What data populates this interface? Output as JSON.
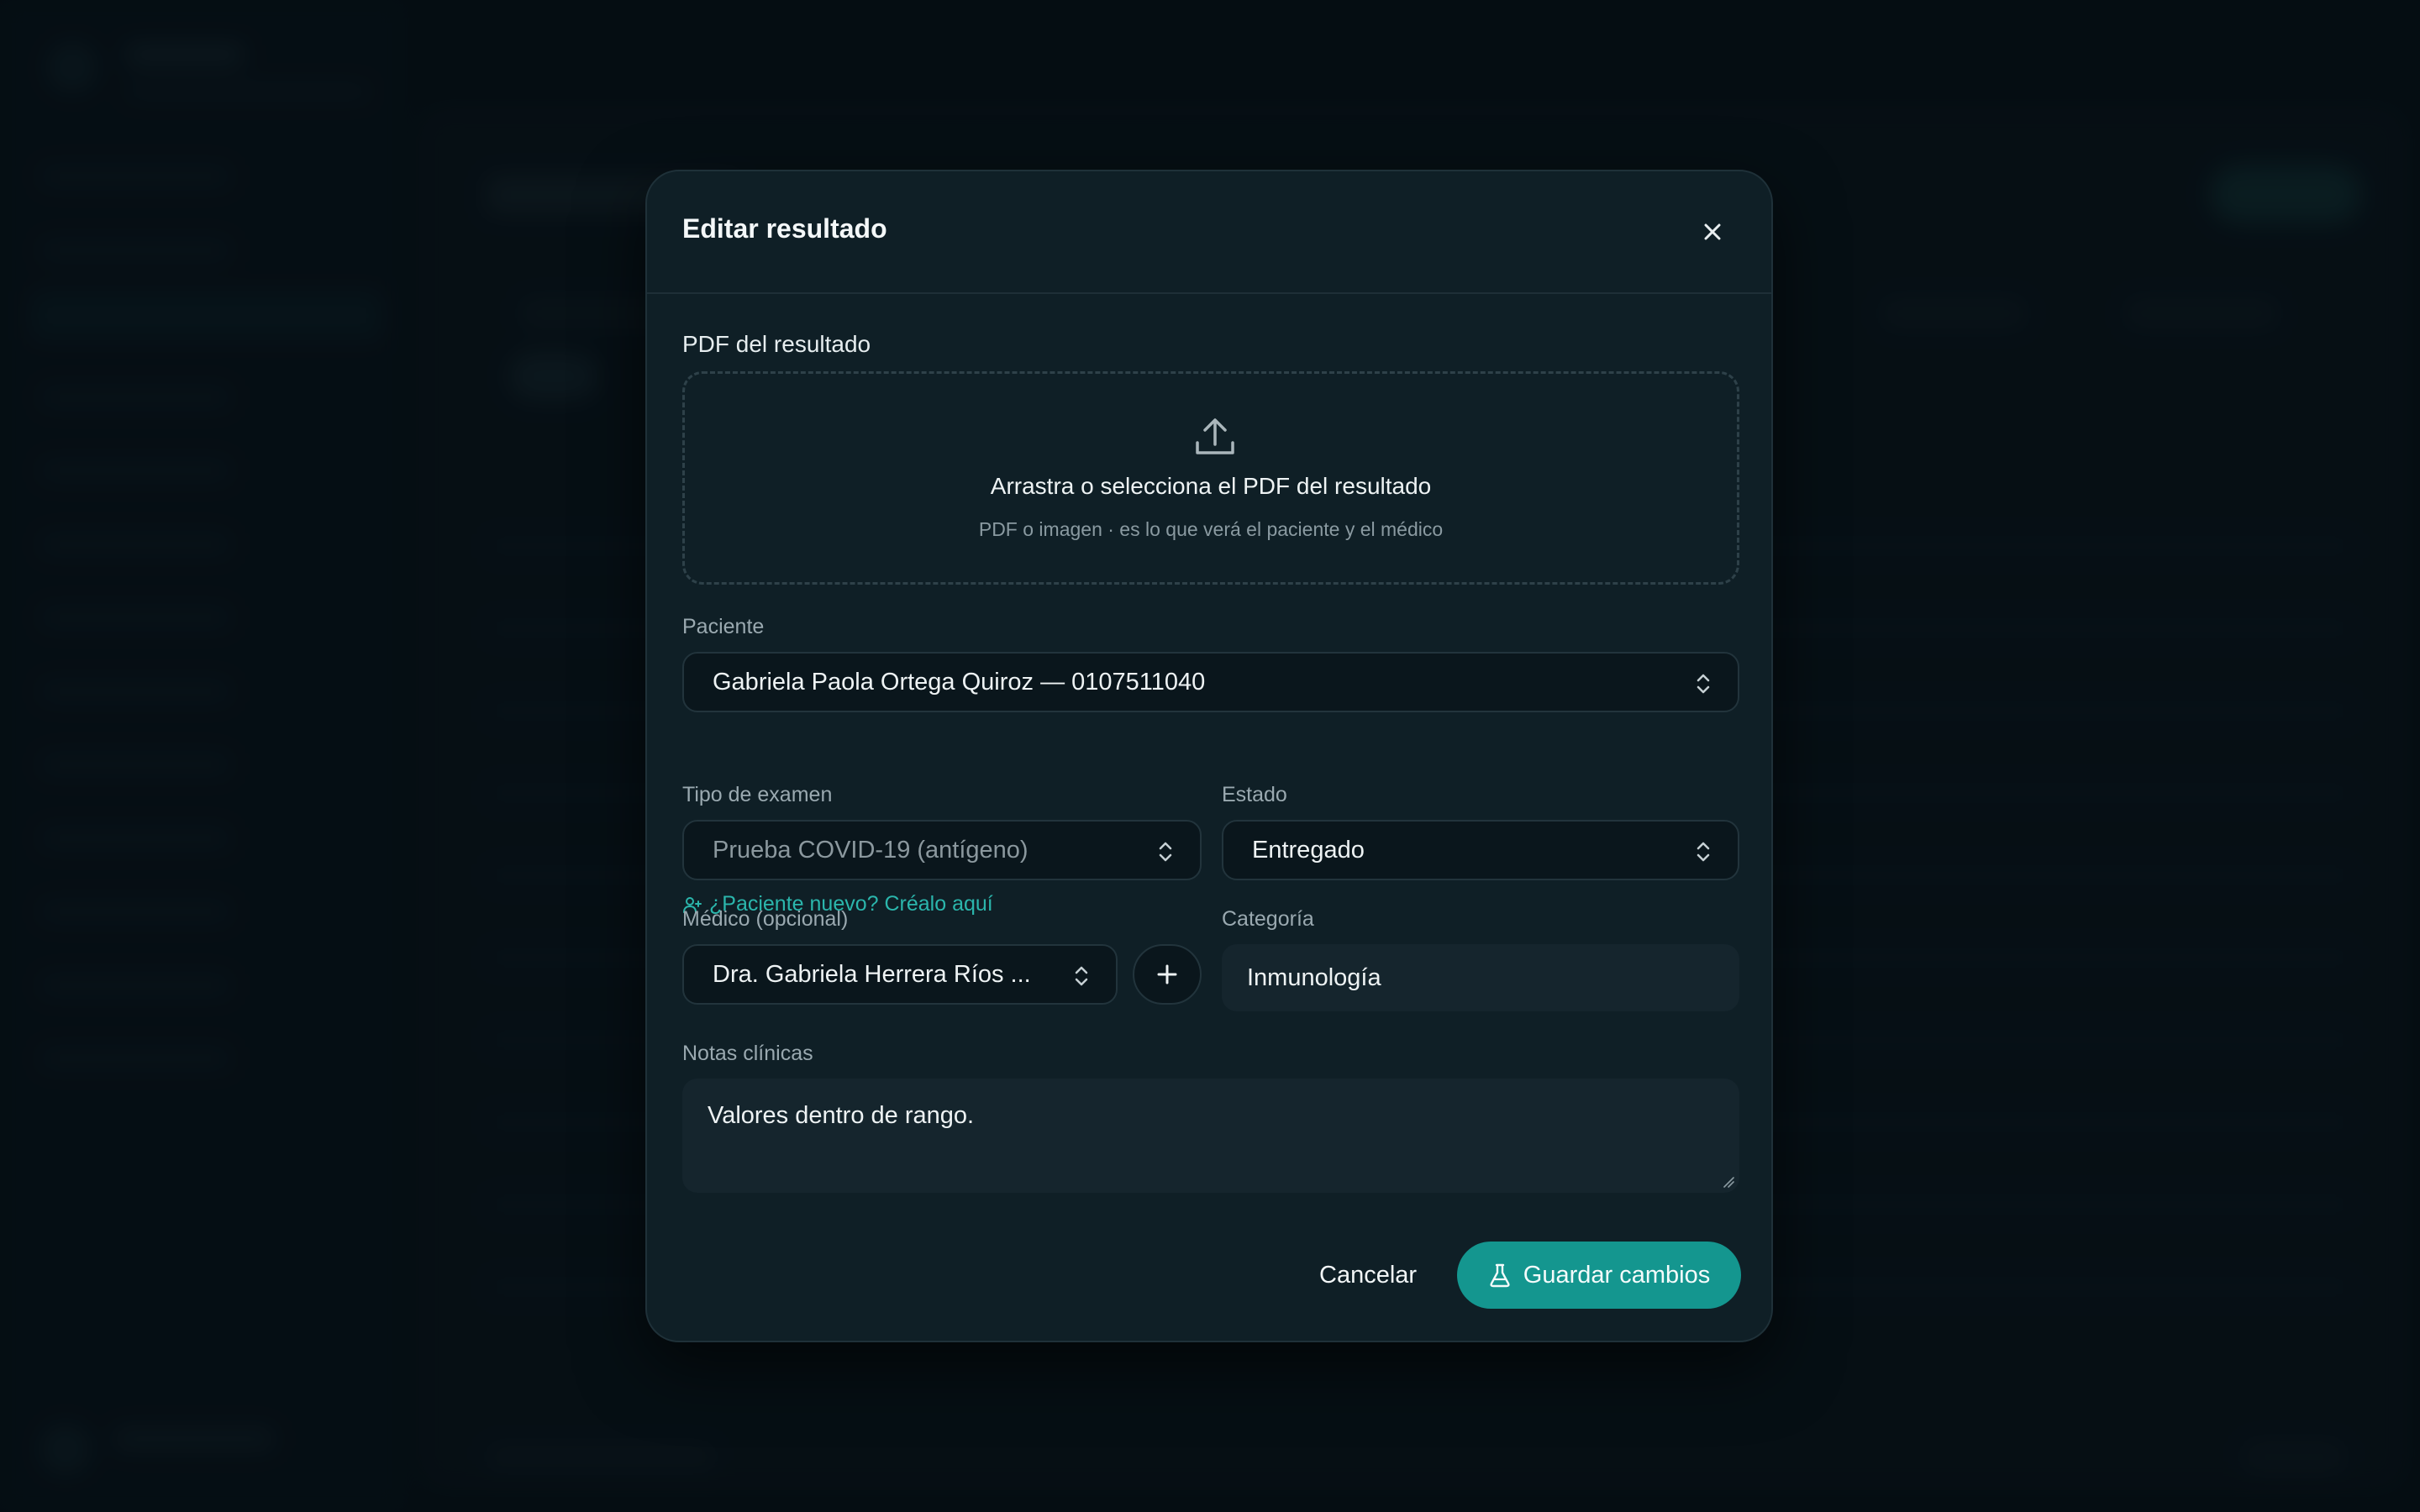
{
  "modal": {
    "title": "Editar resultado",
    "pdf_label": "PDF del resultado",
    "dropzone": {
      "title": "Arrastra o selecciona el PDF del resultado",
      "subtitle": "PDF o imagen · es lo que verá el paciente y el médico"
    },
    "patient": {
      "label": "Paciente",
      "value": "Gabriela Paola Ortega Quiroz — 0107511040",
      "new_link": "¿Paciente nuevo? Créalo aquí"
    },
    "exam_type": {
      "label": "Tipo de examen",
      "value": "Prueba COVID-19 (antígeno)"
    },
    "status": {
      "label": "Estado",
      "value": "Entregado"
    },
    "doctor": {
      "label": "Médico (opcional)",
      "value": "Dra. Gabriela Herrera Ríos ..."
    },
    "category": {
      "label": "Categoría",
      "value": "Inmunología"
    },
    "notes": {
      "label": "Notas clínicas",
      "value": "Valores dentro de rango."
    },
    "actions": {
      "cancel": "Cancelar",
      "save": "Guardar cambios"
    }
  },
  "colors": {
    "accent": "#14968f",
    "link": "#2bb6ac",
    "modal_bg": "#0f1f26",
    "page_bg": "#0a141a"
  },
  "icons": [
    "close-icon",
    "upload-icon",
    "chevron-updown-icon",
    "user-plus-icon",
    "plus-icon",
    "flask-icon"
  ]
}
